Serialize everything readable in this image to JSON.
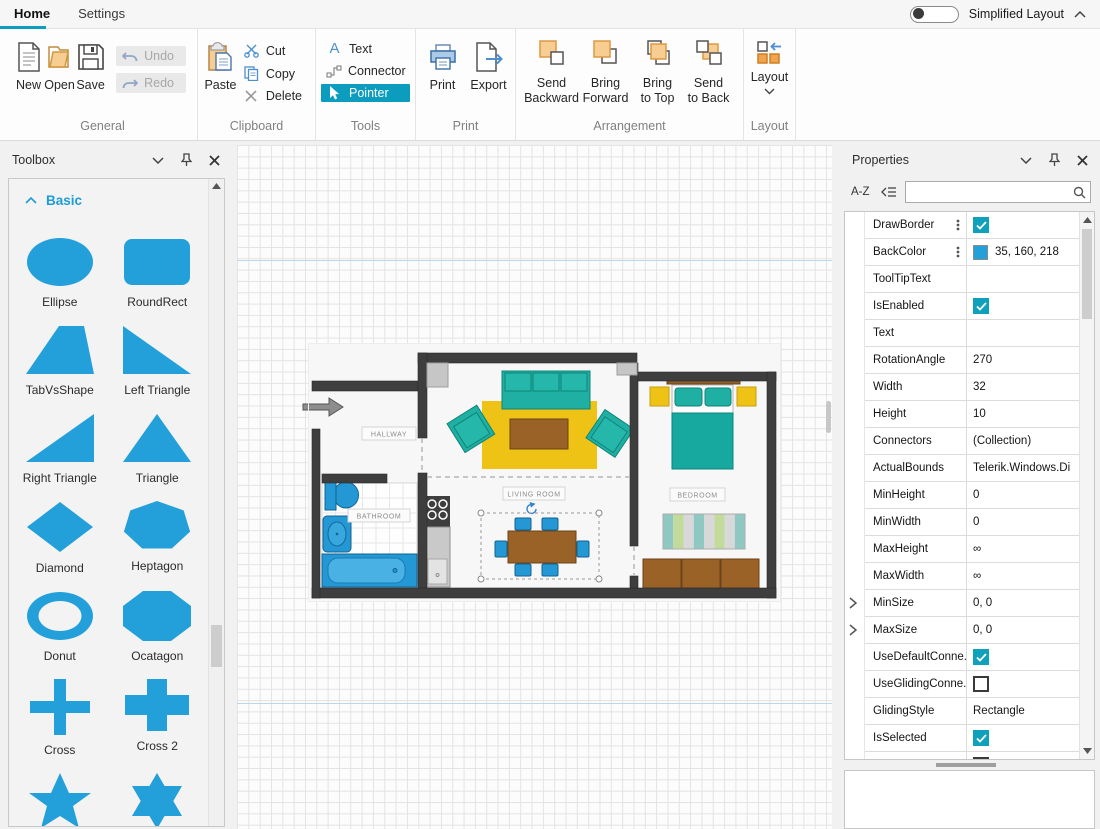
{
  "window": {
    "tabs": [
      {
        "label": "Home",
        "active": true
      },
      {
        "label": "Settings",
        "active": false
      }
    ],
    "simplified_layout_label": "Simplified Layout"
  },
  "colors": {
    "accent": "#0C9DBE",
    "shape_blue": "#239FDA",
    "back_color_swatch": "#23A0DA"
  },
  "ribbon": {
    "general": {
      "label": "General",
      "new": "New",
      "open": "Open",
      "save": "Save",
      "undo": "Undo",
      "redo": "Redo"
    },
    "clipboard": {
      "label": "Clipboard",
      "paste": "Paste",
      "cut": "Cut",
      "copy": "Copy",
      "delete": "Delete"
    },
    "tools": {
      "label": "Tools",
      "text": "Text",
      "connector": "Connector",
      "pointer": "Pointer"
    },
    "print": {
      "label": "Print",
      "print": "Print",
      "export": "Export"
    },
    "arrangement": {
      "label": "Arrangement",
      "items": [
        {
          "line1": "Send",
          "line2": "Backward"
        },
        {
          "line1": "Bring",
          "line2": "Forward"
        },
        {
          "line1": "Bring",
          "line2": "to Top"
        },
        {
          "line1": "Send",
          "line2": "to Back"
        }
      ]
    },
    "layout": {
      "label": "Layout",
      "button": "Layout"
    }
  },
  "toolbox": {
    "title": "Toolbox",
    "section": "Basic",
    "shapes": [
      {
        "label": "Ellipse"
      },
      {
        "label": "RoundRect"
      },
      {
        "label": "TabVsShape"
      },
      {
        "label": "Left Triangle"
      },
      {
        "label": "Right Triangle"
      },
      {
        "label": "Triangle"
      },
      {
        "label": "Diamond"
      },
      {
        "label": "Heptagon"
      },
      {
        "label": "Donut"
      },
      {
        "label": "Ocatagon"
      },
      {
        "label": "Cross"
      },
      {
        "label": "Cross 2"
      },
      {
        "label": ""
      },
      {
        "label": ""
      }
    ]
  },
  "canvas": {
    "plan_labels": {
      "hallway": "HALLWAY",
      "bathroom": "BATHROOM",
      "living_room": "LIVING ROOM",
      "bedroom": "BEDROOM"
    }
  },
  "properties": {
    "title": "Properties",
    "sort_button": "A-Z",
    "search_value": "",
    "rows": [
      {
        "name": "DrawBorder",
        "type": "check",
        "checked": true
      },
      {
        "name": "BackColor",
        "type": "color",
        "value": "35, 160, 218"
      },
      {
        "name": "ToolTipText",
        "type": "text",
        "value": ""
      },
      {
        "name": "IsEnabled",
        "type": "check",
        "checked": true
      },
      {
        "name": "Text",
        "type": "text",
        "value": ""
      },
      {
        "name": "RotationAngle",
        "type": "text",
        "value": "270"
      },
      {
        "name": "Width",
        "type": "text",
        "value": "32"
      },
      {
        "name": "Height",
        "type": "text",
        "value": "10"
      },
      {
        "name": "Connectors",
        "type": "text",
        "value": "(Collection)"
      },
      {
        "name": "ActualBounds",
        "type": "text",
        "value": "Telerik.Windows.Di"
      },
      {
        "name": "MinHeight",
        "type": "text",
        "value": "0"
      },
      {
        "name": "MinWidth",
        "type": "text",
        "value": "0"
      },
      {
        "name": "MaxHeight",
        "type": "text",
        "value": "∞"
      },
      {
        "name": "MaxWidth",
        "type": "text",
        "value": "∞"
      },
      {
        "name": "MinSize",
        "type": "text",
        "value": "0, 0",
        "expandable": true
      },
      {
        "name": "MaxSize",
        "type": "text",
        "value": "0, 0",
        "expandable": true
      },
      {
        "name": "UseDefaultConne...",
        "type": "check",
        "checked": true
      },
      {
        "name": "UseGlidingConne...",
        "type": "check",
        "checked": false
      },
      {
        "name": "GlidingStyle",
        "type": "text",
        "value": "Rectangle"
      },
      {
        "name": "IsSelected",
        "type": "check",
        "checked": true
      }
    ]
  }
}
